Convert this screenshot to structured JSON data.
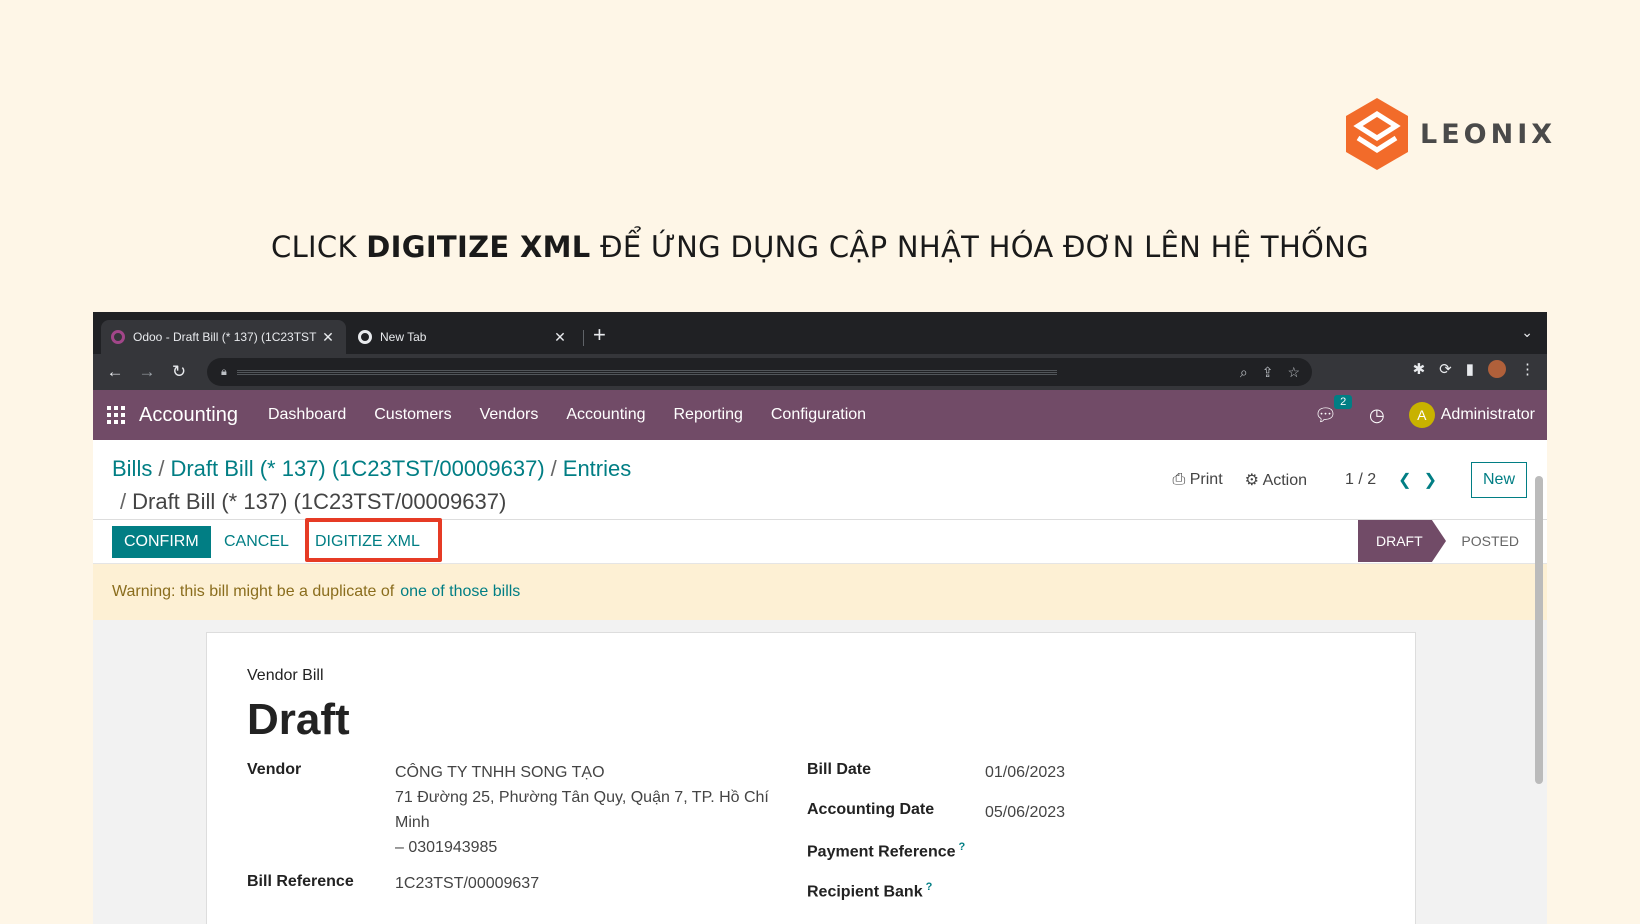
{
  "logo": {
    "text": "LEONIX",
    "brand_color": "#f26b2a"
  },
  "heading": {
    "prefix": "CLICK ",
    "bold": "DIGITIZE XML",
    "suffix": " ĐỂ ỨNG DỤNG CẬP NHẬT HÓA ĐƠN LÊN HỆ THỐNG"
  },
  "browser": {
    "tabs": [
      {
        "title": "Odoo - Draft Bill (* 137) (1C23TST",
        "active": true
      },
      {
        "title": "New Tab",
        "active": false
      }
    ]
  },
  "odoo": {
    "app_name": "Accounting",
    "menu": [
      "Dashboard",
      "Customers",
      "Vendors",
      "Accounting",
      "Reporting",
      "Configuration"
    ],
    "chat_count": "2",
    "user": {
      "initial": "A",
      "name": "Administrator"
    },
    "breadcrumb": {
      "items": [
        "Bills",
        "Draft Bill (* 137) (1C23TST/00009637)",
        "Entries"
      ],
      "current": "Draft Bill (* 137) (1C23TST/00009637)"
    },
    "controls": {
      "print": "Print",
      "action": "Action",
      "pager": "1 / 2",
      "new": "New"
    },
    "buttons": {
      "confirm": "CONFIRM",
      "cancel": "CANCEL",
      "digitize": "DIGITIZE XML"
    },
    "stages": {
      "draft": "DRAFT",
      "posted": "POSTED"
    },
    "warning": {
      "text": "Warning: this bill might be a duplicate of",
      "link": "one of those bills"
    },
    "form": {
      "subtitle": "Vendor Bill",
      "state": "Draft",
      "vendor_label": "Vendor",
      "vendor_name": "CÔNG TY TNHH SONG TẠO",
      "vendor_address": "71 Đường 25, Phường Tân Quy, Quận 7, TP. Hồ Chí Minh",
      "vendor_tax": "– 0301943985",
      "bill_ref_label": "Bill Reference",
      "bill_ref": "1C23TST/00009637",
      "bill_date_label": "Bill Date",
      "bill_date": "01/06/2023",
      "accounting_date_label": "Accounting Date",
      "accounting_date": "05/06/2023",
      "payment_ref_label": "Payment Reference",
      "recipient_bank_label": "Recipient Bank"
    }
  }
}
